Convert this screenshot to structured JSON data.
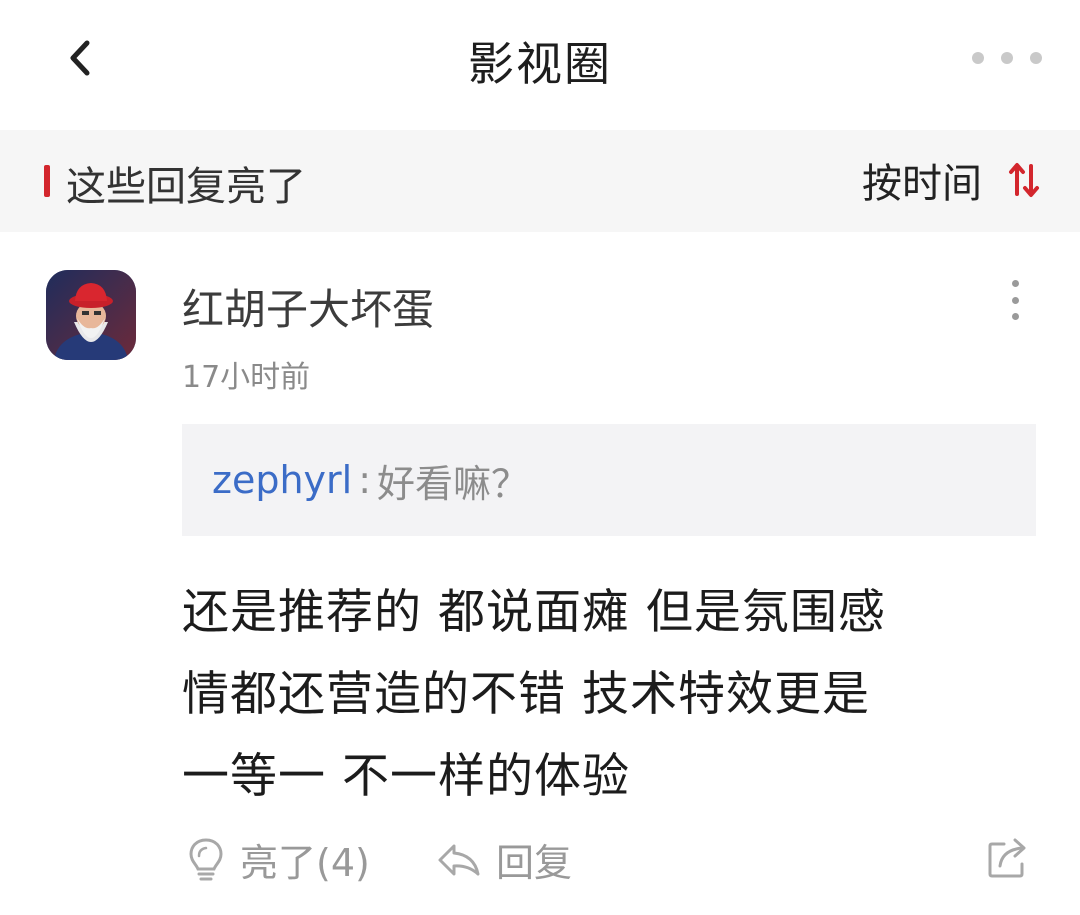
{
  "header": {
    "title": "影视圈",
    "back_icon": "chevron-left-icon",
    "more_icon": "more-horizontal-icon"
  },
  "section": {
    "title": "这些回复亮了",
    "sort_label": "按时间",
    "sort_icon": "sort-arrows-icon",
    "accent_color": "#d3262d"
  },
  "comment": {
    "username": "红胡子大坏蛋",
    "timestamp": "17小时前",
    "quote": {
      "user": "zephyrl",
      "separator": ":",
      "text": "好看嘛？"
    },
    "body_lines": [
      "还是推荐的 都说面瘫 但是氛围感",
      "情都还营造的不错 技术特效更是",
      "一等一 不一样的体验"
    ],
    "actions": {
      "like_label": "亮了(4)",
      "reply_label": "回复",
      "like_icon": "lightbulb-icon",
      "reply_icon": "reply-arrow-icon",
      "share_icon": "share-icon"
    }
  }
}
